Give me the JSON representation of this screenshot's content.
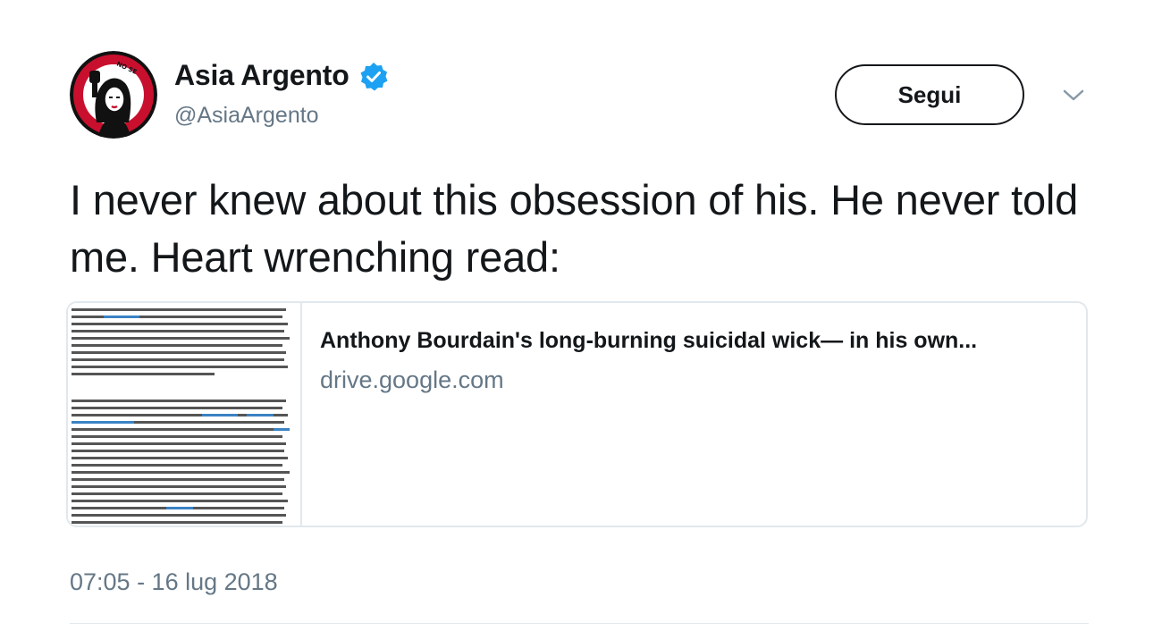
{
  "author": {
    "display_name": "Asia Argento",
    "handle": "@AsiaArgento",
    "verified_icon": "verified-badge-icon",
    "avatar_icon": "avatar-image"
  },
  "actions": {
    "follow_label": "Segui",
    "more_icon": "chevron-down-icon"
  },
  "tweet": {
    "text": "I never knew about this obsession of his. He never told me. Heart wrenching read:",
    "timestamp": "07:05 - 16 lug 2018"
  },
  "link_card": {
    "title": "Anthony Bourdain's long-burning suicidal wick— in his own...",
    "domain": "drive.google.com",
    "thumbnail_icon": "document-thumbnail"
  },
  "colors": {
    "primary_text": "#14171a",
    "secondary_text": "#657786",
    "border": "#e1e8ed",
    "verified_blue": "#1da1f2",
    "avatar_red": "#c8102e"
  }
}
